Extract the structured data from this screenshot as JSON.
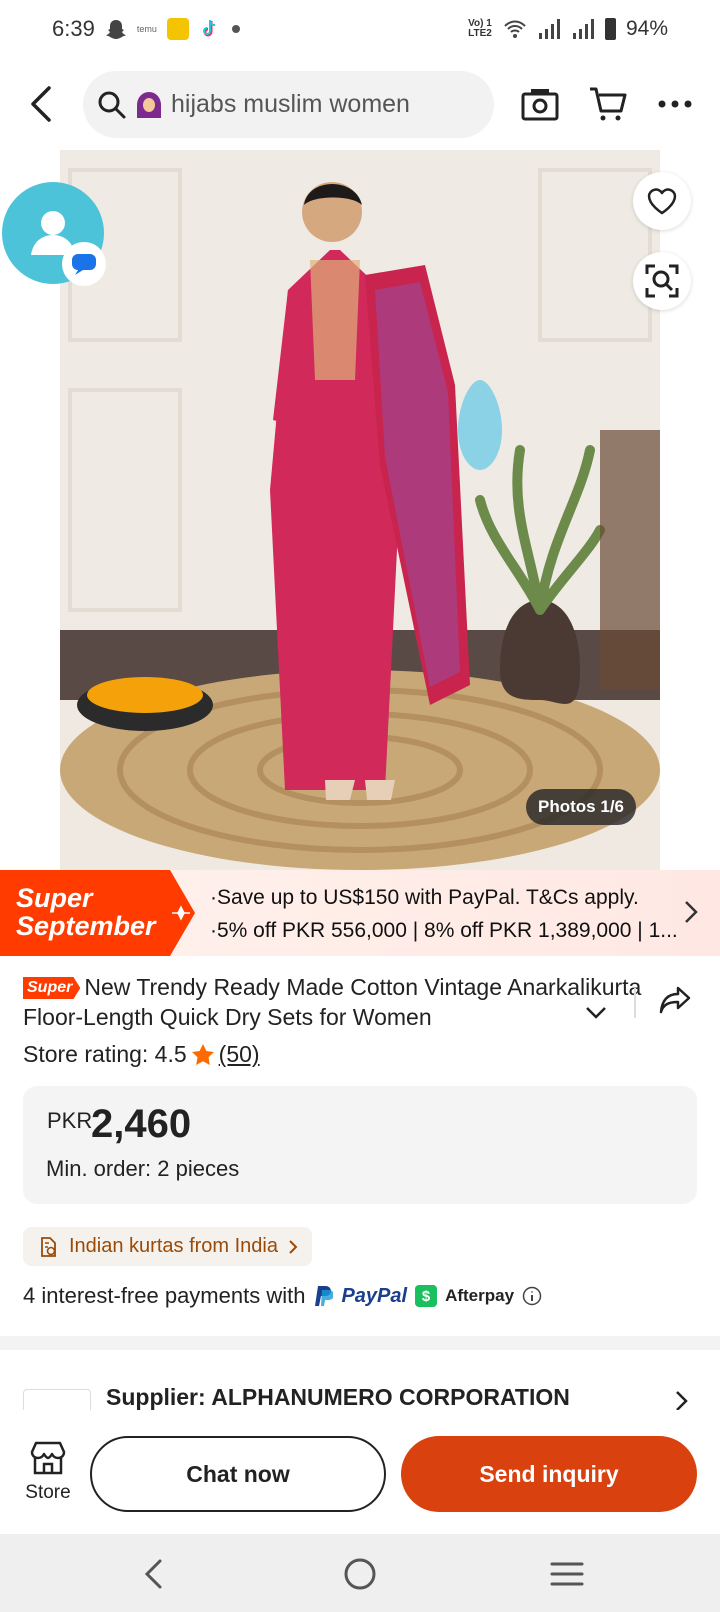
{
  "status_bar": {
    "time": "6:39",
    "network_label": "Vo) 1 LTE2",
    "battery": "94%"
  },
  "search": {
    "query": "hijabs muslim women"
  },
  "product_image": {
    "photo_counter": "Photos 1/6"
  },
  "promo": {
    "tag_line1": "Super",
    "tag_line2": "September",
    "line1": "Save up to US$150 with PayPal. T&Cs apply.",
    "line2": "5% off PKR 556,000 | 8% off PKR 1,389,000 | 1...",
    "accent_color": "#ff3b00"
  },
  "product": {
    "badge": "Super",
    "title": "New Trendy Ready Made Cotton Vintage Anarkalikurta Floor-Length Quick Dry Sets for Women",
    "rating_label": "Store rating: 4.5",
    "rating_count": "(50)",
    "currency": "PKR",
    "price": "2,460",
    "min_order": "Min. order: 2 pieces",
    "origin": "Indian kurtas from India",
    "payment_prefix": "4 interest-free payments with",
    "paypal": "PayPal",
    "afterpay": "Afterpay"
  },
  "supplier": {
    "label": "Supplier:  ALPHANUMERO CORPORATION"
  },
  "actions": {
    "store_label": "Store",
    "chat_label": "Chat now",
    "inquiry_label": "Send inquiry",
    "inquiry_color": "#d9410f"
  }
}
